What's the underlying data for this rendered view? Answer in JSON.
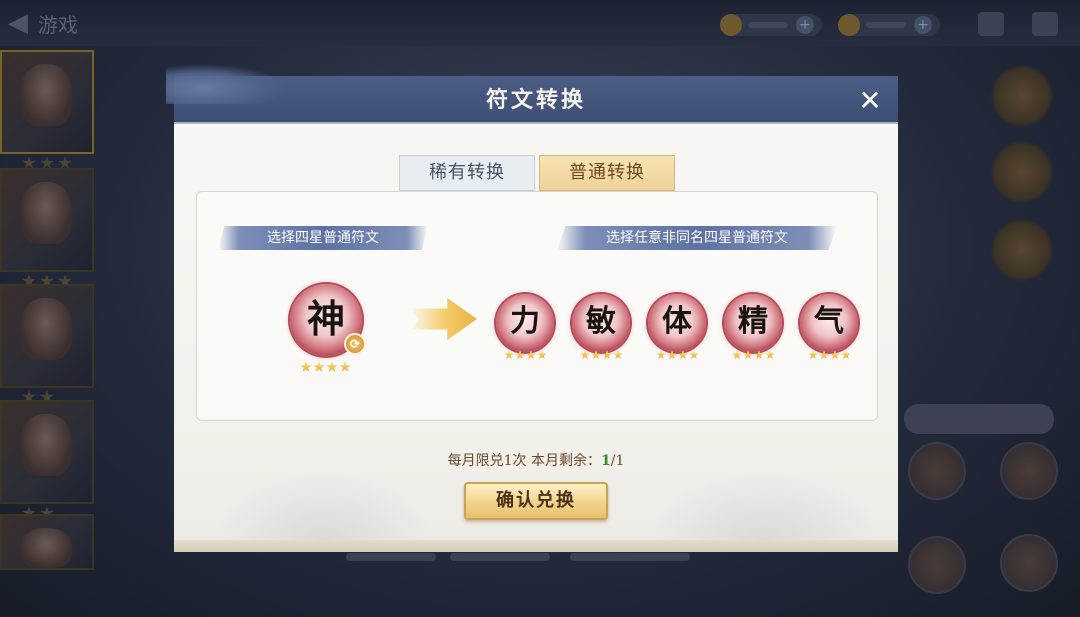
{
  "background": {
    "back_label": "游戏"
  },
  "dialog": {
    "title": "符文转换",
    "close_icon": "close-icon",
    "tabs": [
      {
        "label": "稀有转换",
        "active": false
      },
      {
        "label": "普通转换",
        "active": true
      }
    ],
    "source": {
      "header": "选择四星普通符文",
      "rune": {
        "glyph": "神",
        "stars": 4,
        "badge_icon": "swap-icon"
      }
    },
    "target": {
      "header": "选择任意非同名四星普通符文",
      "runes": [
        {
          "glyph": "力",
          "stars": 4
        },
        {
          "glyph": "敏",
          "stars": 4
        },
        {
          "glyph": "体",
          "stars": 4
        },
        {
          "glyph": "精",
          "stars": 4
        },
        {
          "glyph": "气",
          "stars": 4
        }
      ]
    },
    "limit": {
      "prefix": "每月限兑1次 本月剩余：",
      "remaining": "1",
      "separator": "/",
      "total": "1"
    },
    "confirm_label": "确认兑换"
  },
  "colors": {
    "header_blue": "#4c5e86",
    "tab_active_gold": "#eed29a",
    "rune_red": "#a73d4b",
    "remaining_green": "#3b8a2f"
  }
}
